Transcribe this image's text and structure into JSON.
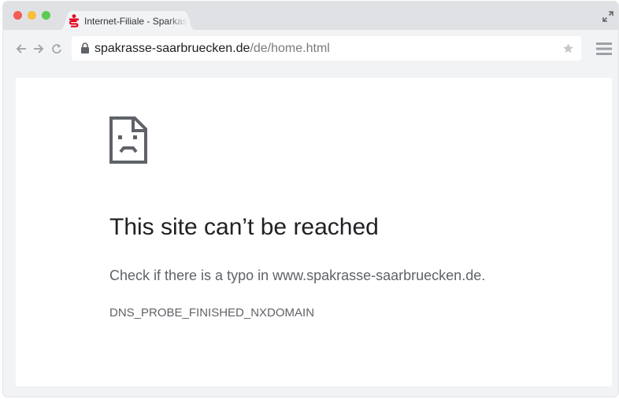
{
  "browser": {
    "tab": {
      "title": "Internet-Filiale - Sparkasse"
    },
    "address_bar": {
      "host": "spakrasse-saarbruecken.de",
      "path": "/de/home.html"
    },
    "colors": {
      "favicon": "#e2001a",
      "traffic_red": "#f45b55",
      "traffic_yellow": "#f6be3a",
      "traffic_green": "#5bcb53"
    },
    "icons": [
      "back-arrow-icon",
      "forward-arrow-icon",
      "reload-icon",
      "lock-icon",
      "star-icon",
      "menu-icon",
      "expand-icon",
      "sparkasse-favicon-icon",
      "sad-document-icon"
    ]
  },
  "error_page": {
    "title": "This site can’t be reached",
    "message": "Check if there is a typo in www.spakrasse-saarbruecken.de.",
    "code": "DNS_PROBE_FINISHED_NXDOMAIN"
  }
}
